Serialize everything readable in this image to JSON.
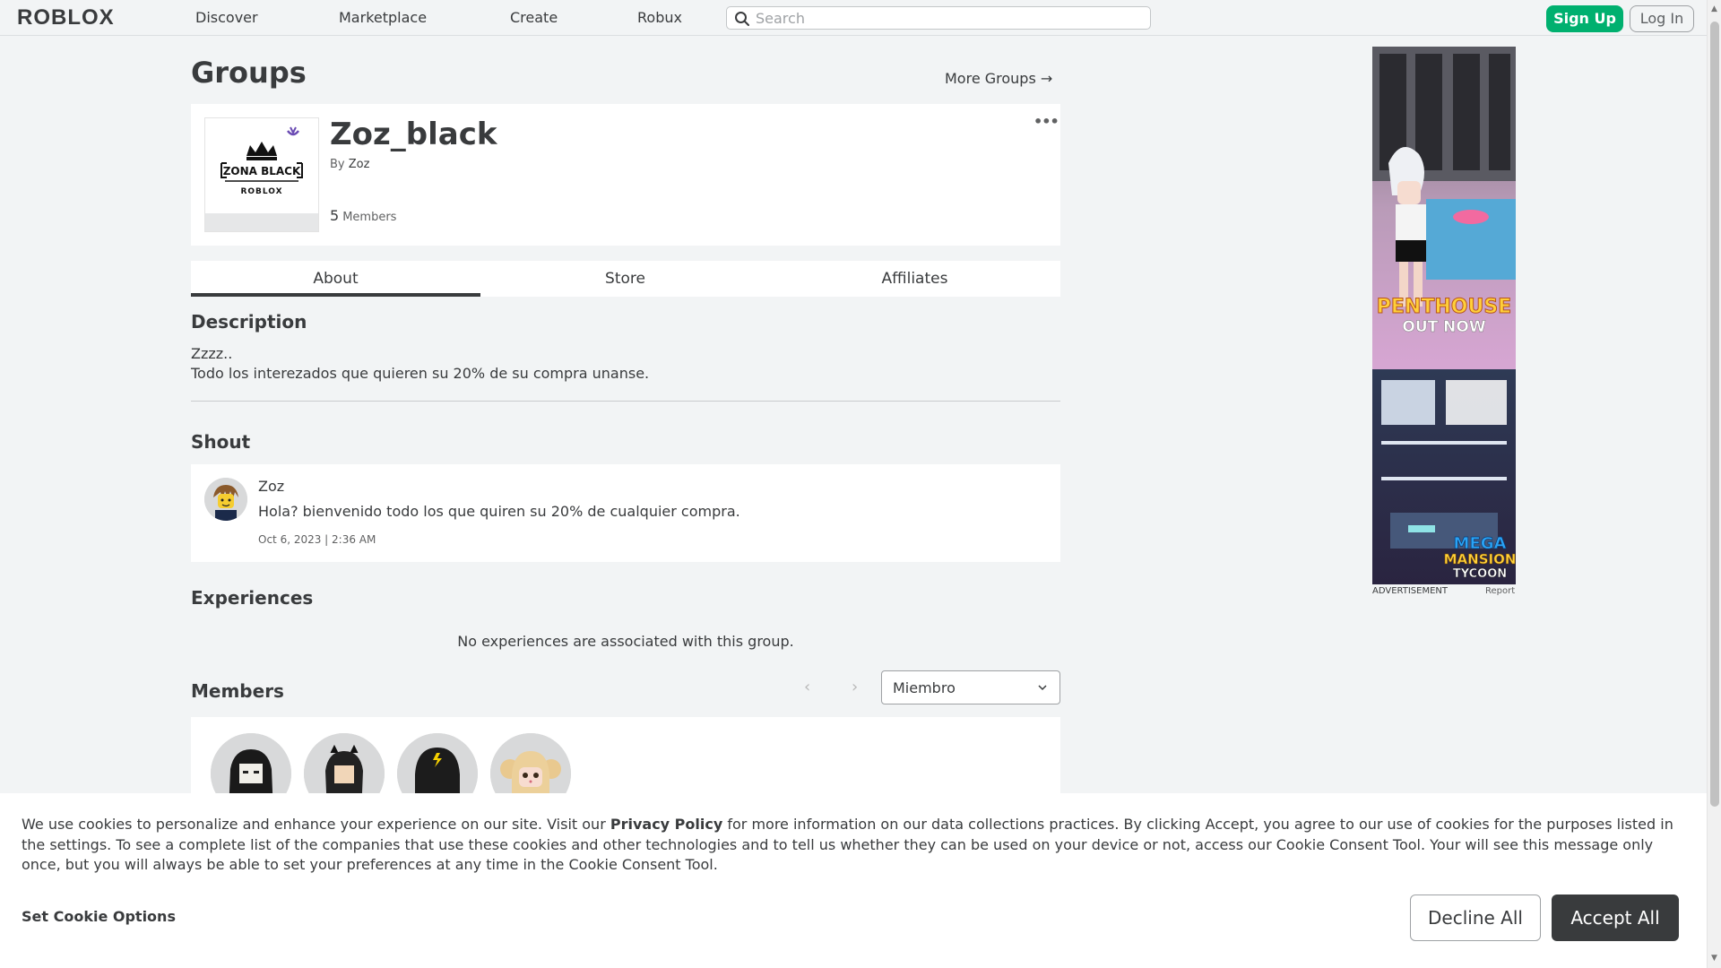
{
  "nav": {
    "logo": "ROBLOX",
    "links": [
      "Discover",
      "Marketplace",
      "Create",
      "Robux"
    ],
    "search_placeholder": "Search",
    "signup": "Sign Up",
    "login": "Log In"
  },
  "page": {
    "title": "Groups",
    "more_groups": "More Groups →"
  },
  "group": {
    "name": "Zoz_black",
    "by_prefix": "By",
    "owner": "Zoz",
    "member_count": "5",
    "member_label": "Members",
    "emblem_text": "ZONA BLACK",
    "emblem_sub": "ROBLOX"
  },
  "tabs": [
    "About",
    "Store",
    "Affiliates"
  ],
  "description": {
    "title": "Description",
    "line1": "Zzzz..",
    "line2": "Todo los interezados que quieren su 20% de su compra unanse."
  },
  "shout": {
    "title": "Shout",
    "author": "Zoz",
    "body": "Hola? bienvenido todo los que quiren su 20% de cualquier compra.",
    "date": "Oct 6, 2023 | 2:36 AM"
  },
  "experiences": {
    "title": "Experiences",
    "empty": "No experiences are associated with this group."
  },
  "members": {
    "title": "Members",
    "role_selected": "Miembro"
  },
  "ad": {
    "headline1": "PENTHOUSE",
    "headline2": "OUT NOW",
    "brand1": "MEGA",
    "brand2": "MANSION",
    "brand3": "TYCOON",
    "label": "ADVERTISEMENT",
    "report": "Report"
  },
  "cookie": {
    "text_a": "We use cookies to personalize and enhance your experience on our site. Visit our ",
    "link": "Privacy Policy",
    "text_b": " for more information on our data collections practices. By clicking Accept, you agree to our use of cookies for the purposes listed in the settings. To see a complete list of the companies that use these cookies and other technologies and to tell us whether they can be used on your device or not, access our Cookie Consent Tool. Your will see this message only once, but you will always be able to set your preferences at any time in the Cookie Consent Tool.",
    "options": "Set Cookie Options",
    "decline": "Decline All",
    "accept": "Accept All"
  },
  "colors": {
    "accent_green": "#00b06f",
    "text": "#393b3d",
    "background": "#f2f4f5"
  }
}
